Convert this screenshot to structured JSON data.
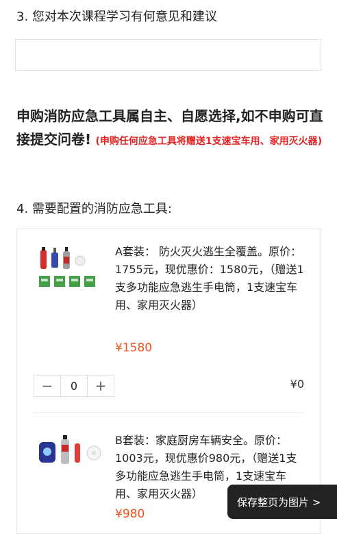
{
  "question3": {
    "title": "3. 您对本次课程学习有何意见和建议",
    "answer_value": ""
  },
  "notice": {
    "main_part1": "申购消防应急工具属自主、自愿选择,如不申购可直接提交问卷",
    "main_part2": "!",
    "red_note": "(申购任何应急工具将赠送1支速宝车用、家用灭火器)"
  },
  "question4": {
    "title": "4. 需要配置的消防应急工具:"
  },
  "products": [
    {
      "description": "A套装： 防火灭火逃生全覆盖。原价：1755元，现优惠价：1580元，（赠送1支多功能应急逃生手电筒，1支速宝车用、家用灭火器）",
      "price": "¥1580",
      "minus_label": "−",
      "quantity": "0",
      "plus_label": "+",
      "line_total": "¥0"
    },
    {
      "description": "B套装：家庭厨房车辆安全。原价：1003元，现优惠价980元，（赠送1支多功能应急逃生手电筒，1支速宝车用、家用灭火器）",
      "price": "¥980"
    }
  ],
  "save_button": {
    "label": "保存整页为图片 >"
  },
  "colors": {
    "accent_red": "#e42323",
    "price_orange": "#f4511e",
    "dark_button": "#222222"
  }
}
